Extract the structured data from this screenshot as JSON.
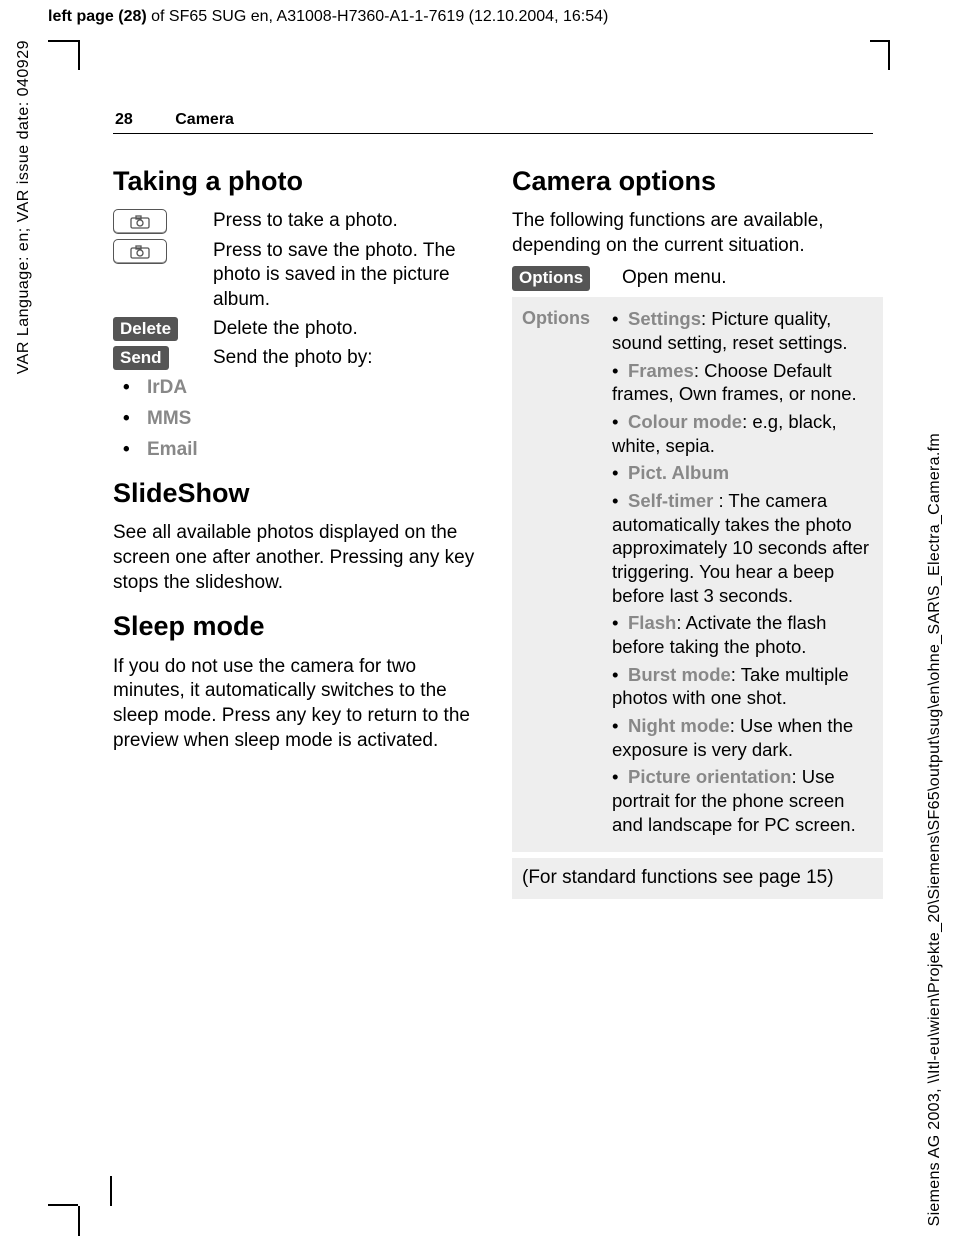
{
  "header": {
    "bold": "left page (28)",
    "rest": " of SF65 SUG en, A31008-H7360-A1-1-7619 (12.10.2004, 16:54)"
  },
  "side_left": "VAR Language: en; VAR issue date: 040929",
  "side_right": "Siemens AG 2003, \\\\Itl-eu\\wien\\Projekte_20\\Siemens\\SF65\\output\\sug\\en\\ohne_SAR\\S_Electra_Camera.fm",
  "page_head": {
    "num": "28",
    "section": "Camera"
  },
  "left": {
    "h_take": "Taking a photo",
    "r1": "Press to take a photo.",
    "r2": "Press to save the photo. The photo is saved in the picture album.",
    "delete_sk": "Delete",
    "delete_desc": "Delete the photo.",
    "send_sk": "Send",
    "send_desc": "Send the photo by:",
    "send_list": [
      "IrDA",
      "MMS",
      "Email"
    ],
    "h_slide": "SlideShow",
    "slide_p": "See all available photos displayed on the screen one after another. Pressing any key stops the slideshow.",
    "h_sleep": "Sleep mode",
    "sleep_p": "If you do not use the camera for two minutes, it automatically switches to the sleep mode. Press any key to return to the preview when sleep mode is activated."
  },
  "right": {
    "h_opts": "Camera options",
    "intro": "The following functions are available, depending on the current situation.",
    "open_sk": "Options",
    "open_desc": "Open menu.",
    "box_label": "Options",
    "items": [
      {
        "t": "Settings",
        "d": ": Picture quality, sound setting, reset settings."
      },
      {
        "t": "Frames",
        "d": ": Choose Default frames, Own frames, or none."
      },
      {
        "t": "Colour mode",
        "d": ": e.g, black, white, sepia."
      },
      {
        "t": "Pict. Album",
        "d": ""
      },
      {
        "t": "Self-timer",
        "d": " : The camera automatically takes the photo approximately 10 seconds after triggering. You hear a beep before last 3 seconds."
      },
      {
        "t": "Flash",
        "d": ": Activate the flash before taking the photo."
      },
      {
        "t": "Burst mode",
        "d": ": Take multiple photos with one shot."
      },
      {
        "t": "Night mode",
        "d": ": Use when the exposure is very dark."
      },
      {
        "t": "Picture orientation",
        "d": ": Use portrait for the phone screen and landscape for PC screen."
      }
    ],
    "footnote": "(For standard functions see page 15)"
  }
}
